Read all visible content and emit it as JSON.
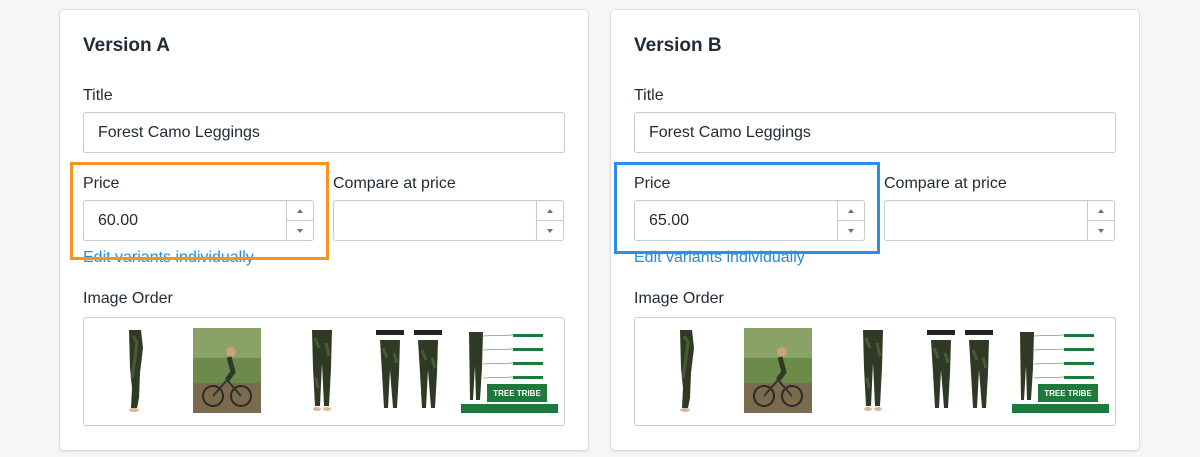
{
  "version_a": {
    "heading": "Version A",
    "title_label": "Title",
    "title_value": "Forest Camo Leggings",
    "price_label": "Price",
    "price_value": "60.00",
    "compare_label": "Compare at price",
    "compare_value": "",
    "edit_variants_link": "Edit variants individually",
    "image_order_label": "Image Order",
    "highlight_color": "#f7941d"
  },
  "version_b": {
    "heading": "Version B",
    "title_label": "Title",
    "title_value": "Forest Camo Leggings",
    "price_label": "Price",
    "price_value": "65.00",
    "compare_label": "Compare at price",
    "compare_value": "",
    "edit_variants_link": "Edit variants individually",
    "image_order_label": "Image Order",
    "highlight_color": "#2b8fe8"
  },
  "images": [
    {
      "name": "leggings-side-view"
    },
    {
      "name": "woman-mountain-biking-photo"
    },
    {
      "name": "leggings-front-view"
    },
    {
      "name": "leggings-front-back-comparison"
    },
    {
      "name": "tree-tribe-leggings-info-banner",
      "banner_text": "TREE TRIBE"
    }
  ],
  "colors": {
    "link": "#2a8bd8",
    "border": "#c4cdd5",
    "camo_dark": "#2f3a25",
    "banner_green": "#1e7a3a"
  }
}
